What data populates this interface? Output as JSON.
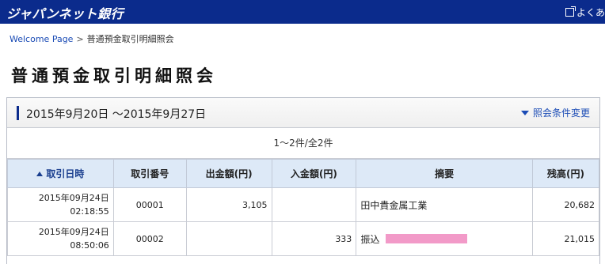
{
  "header": {
    "logo": "ジャパンネット銀行",
    "right_link": "よくあ"
  },
  "breadcrumb": {
    "home": "Welcome Page",
    "separator": ">",
    "current": "普通預金取引明細照会"
  },
  "page_title": "普通預金取引明細照会",
  "panel": {
    "period": "2015年9月20日 〜2015年9月27日",
    "change_link": "照会条件変更",
    "count": "1〜2件/全2件"
  },
  "table": {
    "headers": [
      "取引日時",
      "取引番号",
      "出金額(円)",
      "入金額(円)",
      "摘要",
      "残高(円)"
    ],
    "rows": [
      {
        "date": "2015年09月24日",
        "time": "02:18:55",
        "number": "00001",
        "withdrawal": "3,105",
        "deposit": "",
        "memo": "田中貴金属工業",
        "balance": "20,682"
      },
      {
        "date": "2015年09月24日",
        "time": "08:50:06",
        "number": "00002",
        "withdrawal": "",
        "deposit": "333",
        "memo": "振込",
        "balance": "21,015"
      }
    ]
  },
  "colors": {
    "brand": "#0b2b8c",
    "link": "#1a4bb5",
    "header_bg": "#dde9f7",
    "redaction": "#f29ac8"
  },
  "icons": {
    "external_link": "external-link-icon",
    "dropdown": "triangle-down-icon",
    "sort": "sort-ascending-icon"
  }
}
